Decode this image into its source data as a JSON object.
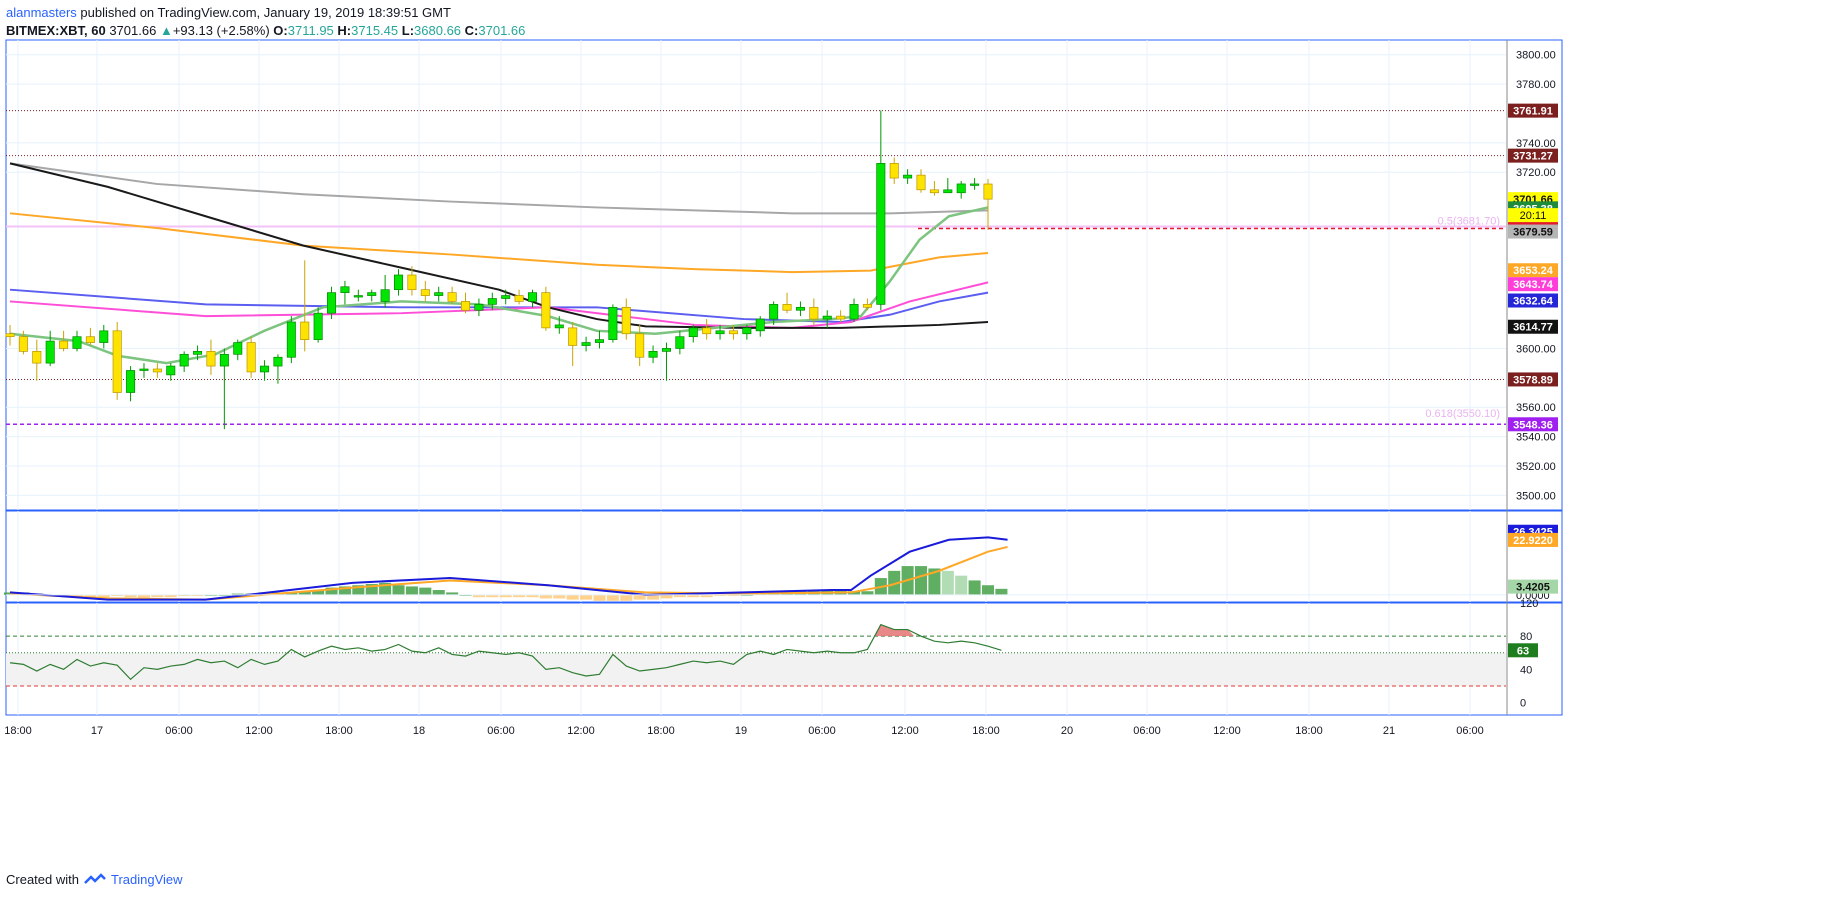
{
  "header": {
    "user": "alanmasters",
    "published": " published on TradingView.com, January 19, 2019 18:39:51 GMT",
    "symbol": "BITMEX:XBT, 60",
    "last": "3701.66",
    "change": "+93.13 (+2.58%)",
    "o_label": "O:",
    "o": "3711.95",
    "h_label": "H:",
    "h": "3715.45",
    "l_label": "L:",
    "l": "3680.66",
    "c_label": "C:",
    "c": "3701.66"
  },
  "footer": {
    "created": "Created with",
    "brand": "TradingView"
  },
  "colors": {
    "up": "#00e600",
    "down": "#ffe300",
    "grid": "#e6f2fb",
    "border": "#2962ff",
    "ema_black": "#1a1a1a",
    "ema_gray": "#a7a7a7",
    "ema_orange": "#ffa726",
    "ema_blue": "#5b5ef0",
    "ema_magenta": "#ff4fd8",
    "ema_green": "#7cc47f"
  },
  "chart_data": [
    {
      "type": "candlestick",
      "title": "",
      "ylim": [
        3490,
        3810
      ],
      "x_ticks": [
        "18:00",
        "17",
        "06:00",
        "12:00",
        "18:00",
        "18",
        "06:00",
        "12:00",
        "18:00",
        "19",
        "06:00",
        "12:00",
        "18:00",
        "20",
        "06:00",
        "12:00",
        "18:00",
        "21",
        "06:00"
      ],
      "y_ticks": [
        "3800.00",
        "3780.00",
        "3740.00",
        "3720.00",
        "3600.00",
        "3560.00",
        "3540.00",
        "3520.00",
        "3500.00"
      ],
      "candles": [
        {
          "o": 3610,
          "h": 3616,
          "l": 3602,
          "c": 3608
        },
        {
          "o": 3608,
          "h": 3612,
          "l": 3596,
          "c": 3598
        },
        {
          "o": 3598,
          "h": 3606,
          "l": 3578,
          "c": 3590
        },
        {
          "o": 3590,
          "h": 3612,
          "l": 3588,
          "c": 3605
        },
        {
          "o": 3605,
          "h": 3612,
          "l": 3598,
          "c": 3600
        },
        {
          "o": 3600,
          "h": 3612,
          "l": 3598,
          "c": 3608
        },
        {
          "o": 3608,
          "h": 3614,
          "l": 3602,
          "c": 3604
        },
        {
          "o": 3604,
          "h": 3616,
          "l": 3600,
          "c": 3612
        },
        {
          "o": 3612,
          "h": 3618,
          "l": 3565,
          "c": 3570
        },
        {
          "o": 3570,
          "h": 3588,
          "l": 3564,
          "c": 3585
        },
        {
          "o": 3585,
          "h": 3590,
          "l": 3580,
          "c": 3586
        },
        {
          "o": 3586,
          "h": 3590,
          "l": 3580,
          "c": 3584
        },
        {
          "o": 3582,
          "h": 3590,
          "l": 3578,
          "c": 3588
        },
        {
          "o": 3588,
          "h": 3598,
          "l": 3584,
          "c": 3596
        },
        {
          "o": 3596,
          "h": 3602,
          "l": 3592,
          "c": 3598
        },
        {
          "o": 3598,
          "h": 3606,
          "l": 3582,
          "c": 3588
        },
        {
          "o": 3588,
          "h": 3600,
          "l": 3545,
          "c": 3596
        },
        {
          "o": 3596,
          "h": 3606,
          "l": 3592,
          "c": 3604
        },
        {
          "o": 3604,
          "h": 3608,
          "l": 3580,
          "c": 3584
        },
        {
          "o": 3584,
          "h": 3592,
          "l": 3578,
          "c": 3588
        },
        {
          "o": 3588,
          "h": 3596,
          "l": 3576,
          "c": 3594
        },
        {
          "o": 3594,
          "h": 3622,
          "l": 3590,
          "c": 3618
        },
        {
          "o": 3618,
          "h": 3660,
          "l": 3598,
          "c": 3606
        },
        {
          "o": 3606,
          "h": 3628,
          "l": 3604,
          "c": 3624
        },
        {
          "o": 3624,
          "h": 3642,
          "l": 3620,
          "c": 3638
        },
        {
          "o": 3638,
          "h": 3646,
          "l": 3630,
          "c": 3642
        },
        {
          "o": 3636,
          "h": 3640,
          "l": 3632,
          "c": 3636
        },
        {
          "o": 3636,
          "h": 3640,
          "l": 3632,
          "c": 3638
        },
        {
          "o": 3632,
          "h": 3650,
          "l": 3628,
          "c": 3640
        },
        {
          "o": 3640,
          "h": 3654,
          "l": 3636,
          "c": 3650
        },
        {
          "o": 3650,
          "h": 3656,
          "l": 3636,
          "c": 3640
        },
        {
          "o": 3640,
          "h": 3646,
          "l": 3632,
          "c": 3636
        },
        {
          "o": 3636,
          "h": 3642,
          "l": 3632,
          "c": 3638
        },
        {
          "o": 3638,
          "h": 3642,
          "l": 3630,
          "c": 3632
        },
        {
          "o": 3632,
          "h": 3638,
          "l": 3624,
          "c": 3626
        },
        {
          "o": 3626,
          "h": 3634,
          "l": 3622,
          "c": 3630
        },
        {
          "o": 3630,
          "h": 3638,
          "l": 3626,
          "c": 3634
        },
        {
          "o": 3634,
          "h": 3640,
          "l": 3630,
          "c": 3636
        },
        {
          "o": 3636,
          "h": 3640,
          "l": 3630,
          "c": 3632
        },
        {
          "o": 3632,
          "h": 3640,
          "l": 3628,
          "c": 3638
        },
        {
          "o": 3638,
          "h": 3642,
          "l": 3612,
          "c": 3614
        },
        {
          "o": 3614,
          "h": 3622,
          "l": 3610,
          "c": 3616
        },
        {
          "o": 3614,
          "h": 3618,
          "l": 3588,
          "c": 3602
        },
        {
          "o": 3602,
          "h": 3608,
          "l": 3598,
          "c": 3604
        },
        {
          "o": 3604,
          "h": 3612,
          "l": 3600,
          "c": 3606
        },
        {
          "o": 3606,
          "h": 3630,
          "l": 3604,
          "c": 3628
        },
        {
          "o": 3628,
          "h": 3634,
          "l": 3606,
          "c": 3610
        },
        {
          "o": 3610,
          "h": 3616,
          "l": 3588,
          "c": 3594
        },
        {
          "o": 3594,
          "h": 3602,
          "l": 3590,
          "c": 3598
        },
        {
          "o": 3598,
          "h": 3604,
          "l": 3578,
          "c": 3600
        },
        {
          "o": 3600,
          "h": 3612,
          "l": 3596,
          "c": 3608
        },
        {
          "o": 3608,
          "h": 3616,
          "l": 3604,
          "c": 3614
        },
        {
          "o": 3614,
          "h": 3620,
          "l": 3606,
          "c": 3610
        },
        {
          "o": 3610,
          "h": 3616,
          "l": 3606,
          "c": 3612
        },
        {
          "o": 3612,
          "h": 3616,
          "l": 3606,
          "c": 3610
        },
        {
          "o": 3610,
          "h": 3616,
          "l": 3606,
          "c": 3614
        },
        {
          "o": 3612,
          "h": 3622,
          "l": 3608,
          "c": 3620
        },
        {
          "o": 3620,
          "h": 3632,
          "l": 3616,
          "c": 3630
        },
        {
          "o": 3630,
          "h": 3638,
          "l": 3624,
          "c": 3626
        },
        {
          "o": 3626,
          "h": 3632,
          "l": 3622,
          "c": 3628
        },
        {
          "o": 3628,
          "h": 3634,
          "l": 3616,
          "c": 3620
        },
        {
          "o": 3620,
          "h": 3626,
          "l": 3614,
          "c": 3622
        },
        {
          "o": 3622,
          "h": 3626,
          "l": 3618,
          "c": 3620
        },
        {
          "o": 3620,
          "h": 3634,
          "l": 3618,
          "c": 3630
        },
        {
          "o": 3630,
          "h": 3634,
          "l": 3626,
          "c": 3628
        },
        {
          "o": 3630,
          "h": 3762,
          "l": 3626,
          "c": 3726
        },
        {
          "o": 3726,
          "h": 3730,
          "l": 3712,
          "c": 3716
        },
        {
          "o": 3716,
          "h": 3722,
          "l": 3712,
          "c": 3718
        },
        {
          "o": 3718,
          "h": 3722,
          "l": 3706,
          "c": 3708
        },
        {
          "o": 3708,
          "h": 3714,
          "l": 3704,
          "c": 3706
        },
        {
          "o": 3706,
          "h": 3716,
          "l": 3706,
          "c": 3708
        },
        {
          "o": 3706,
          "h": 3714,
          "l": 3702,
          "c": 3712
        },
        {
          "o": 3712,
          "h": 3716,
          "l": 3708,
          "c": 3712
        },
        {
          "o": 3711.95,
          "h": 3715.45,
          "l": 3680.66,
          "c": 3701.66
        }
      ],
      "ema_black": [
        [
          0,
          3726
        ],
        [
          10,
          3710
        ],
        [
          20,
          3690
        ],
        [
          30,
          3670
        ],
        [
          40,
          3655
        ],
        [
          50,
          3640
        ],
        [
          55,
          3628
        ],
        [
          60,
          3620
        ],
        [
          65,
          3615
        ],
        [
          75,
          3614
        ],
        [
          85,
          3614
        ],
        [
          95,
          3616
        ],
        [
          100,
          3618
        ]
      ],
      "ema_gray": [
        [
          0,
          3726
        ],
        [
          15,
          3712
        ],
        [
          30,
          3705
        ],
        [
          45,
          3700
        ],
        [
          60,
          3696
        ],
        [
          70,
          3694
        ],
        [
          80,
          3692
        ],
        [
          90,
          3692
        ],
        [
          100,
          3694
        ]
      ],
      "ema_orange": [
        [
          0,
          3692
        ],
        [
          15,
          3682
        ],
        [
          30,
          3670
        ],
        [
          45,
          3664
        ],
        [
          60,
          3657
        ],
        [
          70,
          3654
        ],
        [
          80,
          3652
        ],
        [
          88,
          3653
        ],
        [
          95,
          3662
        ],
        [
          100,
          3665
        ]
      ],
      "ema_blue": [
        [
          0,
          3640
        ],
        [
          20,
          3630
        ],
        [
          40,
          3628
        ],
        [
          60,
          3628
        ],
        [
          75,
          3620
        ],
        [
          85,
          3618
        ],
        [
          90,
          3623
        ],
        [
          95,
          3632
        ],
        [
          100,
          3638
        ]
      ],
      "ema_magenta": [
        [
          0,
          3632
        ],
        [
          20,
          3622
        ],
        [
          40,
          3624
        ],
        [
          55,
          3628
        ],
        [
          70,
          3616
        ],
        [
          80,
          3614
        ],
        [
          86,
          3618
        ],
        [
          92,
          3632
        ],
        [
          100,
          3645
        ]
      ],
      "ema_green": [
        [
          0,
          3610
        ],
        [
          7,
          3605
        ],
        [
          11,
          3595
        ],
        [
          16,
          3590
        ],
        [
          21,
          3596
        ],
        [
          26,
          3612
        ],
        [
          32,
          3628
        ],
        [
          40,
          3632
        ],
        [
          48,
          3630
        ],
        [
          55,
          3622
        ],
        [
          60,
          3612
        ],
        [
          66,
          3610
        ],
        [
          72,
          3614
        ],
        [
          78,
          3618
        ],
        [
          84,
          3620
        ],
        [
          87,
          3622
        ],
        [
          90,
          3646
        ],
        [
          93,
          3674
        ],
        [
          96,
          3690
        ],
        [
          100,
          3696
        ]
      ],
      "horizontal_levels": [
        {
          "price": 3761.91,
          "label": "3761.91",
          "color": "#7b1f1f",
          "dash": "dotted"
        },
        {
          "price": 3731.27,
          "label": "3731.27",
          "color": "#7b1f1f",
          "dash": "dotted"
        },
        {
          "price": 3701.66,
          "label": "3701.66",
          "color": "#ffff00",
          "dash": "none"
        },
        {
          "price": 3695.38,
          "label": "3695.38",
          "color": "#1e8c3a",
          "dash": "none"
        },
        {
          "price": 3681.67,
          "label": "3681.67",
          "color": "#e5192c",
          "dash": "dashed"
        },
        {
          "price": 3679.59,
          "label": "3679.59",
          "color": "#b5b5b5",
          "dash": "none"
        },
        {
          "price": 3653.24,
          "label": "3653.24",
          "color": "#ffa726",
          "dash": "none"
        },
        {
          "price": 3643.74,
          "label": "3643.74",
          "color": "#ff3dd8",
          "dash": "none"
        },
        {
          "price": 3632.64,
          "label": "3632.64",
          "color": "#2626d9",
          "dash": "none"
        },
        {
          "price": 3614.77,
          "label": "3614.77",
          "color": "#111111",
          "dash": "none"
        },
        {
          "price": 3578.89,
          "label": "3578.89",
          "color": "#7b1f1f",
          "dash": "dotted"
        },
        {
          "price": 3548.36,
          "label": "3548.36",
          "color": "#a020f0",
          "dash": "dashed"
        }
      ],
      "countdown": "20:11",
      "fib_labels": [
        {
          "text": "0.5(3681.70)",
          "price": 3683
        },
        {
          "text": "0.618(3550.10)",
          "price": 3552
        }
      ]
    },
    {
      "type": "histogram",
      "title": "",
      "ylim": [
        -3,
        35
      ],
      "y_ticks": [
        "0.0000"
      ],
      "labels": [
        "26.3425",
        "22.9220",
        "3.4205"
      ],
      "histogram": [
        1,
        1,
        0.5,
        -0.5,
        -0.5,
        -1,
        -1,
        -1,
        -0.5,
        -1,
        -1.5,
        -1,
        -1,
        -0.5,
        -0.5,
        0,
        0,
        0.5,
        0.5,
        1,
        1,
        1,
        1.5,
        2,
        3,
        3.5,
        4,
        4.5,
        5,
        4,
        3.5,
        3,
        2,
        1,
        0,
        -1,
        -1,
        -1,
        -1,
        -1,
        -1.5,
        -1.5,
        -2,
        -2,
        -2.5,
        -2.5,
        -2.5,
        -2,
        -2,
        -1.5,
        -1,
        -1,
        -1,
        -0.5,
        -0.5,
        0,
        0.5,
        1,
        1.5,
        1.5,
        1.5,
        2,
        2,
        1.5,
        1.5,
        7,
        10,
        12,
        12,
        11,
        10,
        8,
        6,
        4,
        2.5
      ],
      "line_blue": [
        [
          0,
          1
        ],
        [
          10,
          -2
        ],
        [
          20,
          -2
        ],
        [
          35,
          5
        ],
        [
          45,
          7
        ],
        [
          55,
          4
        ],
        [
          65,
          0
        ],
        [
          75,
          1
        ],
        [
          84,
          2
        ],
        [
          86,
          2
        ],
        [
          88,
          8
        ],
        [
          92,
          18
        ],
        [
          96,
          23
        ],
        [
          100,
          24
        ],
        [
          102,
          23
        ]
      ],
      "line_orange": [
        [
          0,
          0.5
        ],
        [
          10,
          -1.5
        ],
        [
          20,
          -2
        ],
        [
          35,
          3
        ],
        [
          45,
          6
        ],
        [
          55,
          4
        ],
        [
          65,
          1
        ],
        [
          75,
          0.5
        ],
        [
          86,
          1
        ],
        [
          90,
          4
        ],
        [
          95,
          10
        ],
        [
          100,
          18
        ],
        [
          102,
          20
        ]
      ]
    },
    {
      "type": "line",
      "title": "",
      "ylim": [
        -15,
        120
      ],
      "y_ticks": [
        "120",
        "80",
        "40",
        "0"
      ],
      "labels": [
        "63"
      ],
      "series": [
        {
          "values": [
            48,
            46,
            38,
            46,
            40,
            52,
            44,
            48,
            45,
            28,
            42,
            40,
            44,
            46,
            52,
            48,
            50,
            42,
            52,
            46,
            50,
            64,
            55,
            62,
            68,
            64,
            66,
            62,
            64,
            70,
            62,
            60,
            66,
            58,
            56,
            62,
            60,
            58,
            60,
            56,
            40,
            42,
            36,
            32,
            34,
            58,
            44,
            38,
            40,
            42,
            46,
            50,
            48,
            50,
            46,
            58,
            62,
            58,
            64,
            62,
            60,
            62,
            60,
            60,
            64,
            94,
            88,
            88,
            80,
            74,
            72,
            74,
            72,
            68,
            63
          ]
        }
      ],
      "bands": [
        80,
        60,
        20
      ]
    }
  ]
}
